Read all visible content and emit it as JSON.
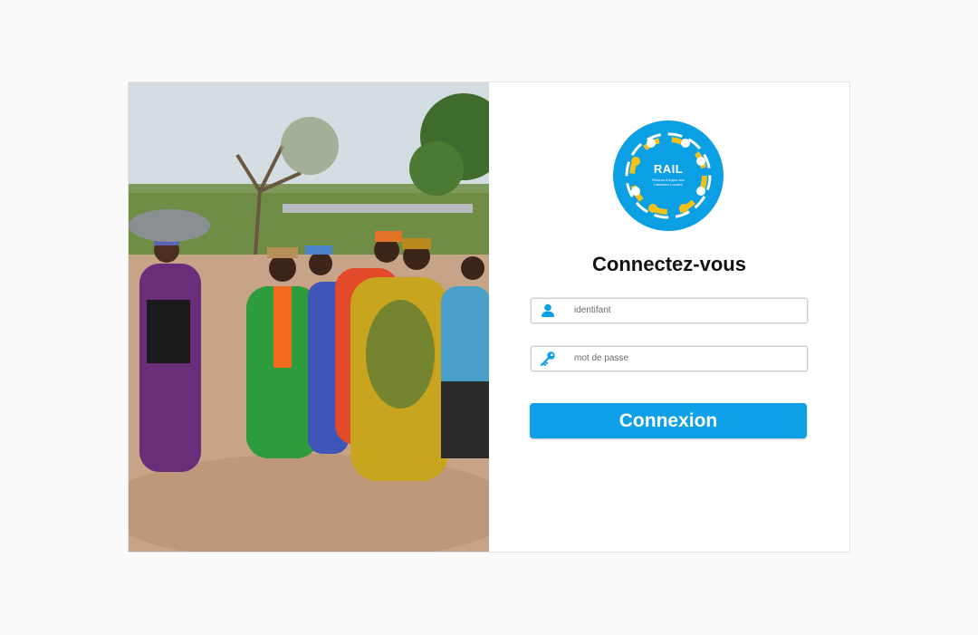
{
  "photo": {
    "alt": ""
  },
  "logo": {
    "name": "RAIL",
    "tagline": "Réseau d'Appui aux Initiatives Locales"
  },
  "login": {
    "title": "Connectez-vous",
    "username_placeholder": "identifant",
    "password_placeholder": "mot de passe",
    "submit_label": "Connexion"
  },
  "icons": {
    "user": "user-icon",
    "password": "key-icon"
  },
  "colors": {
    "accent": "#0ea0e6",
    "logo_blue": "#0b9fe3",
    "logo_yellow": "#f2c21a"
  }
}
